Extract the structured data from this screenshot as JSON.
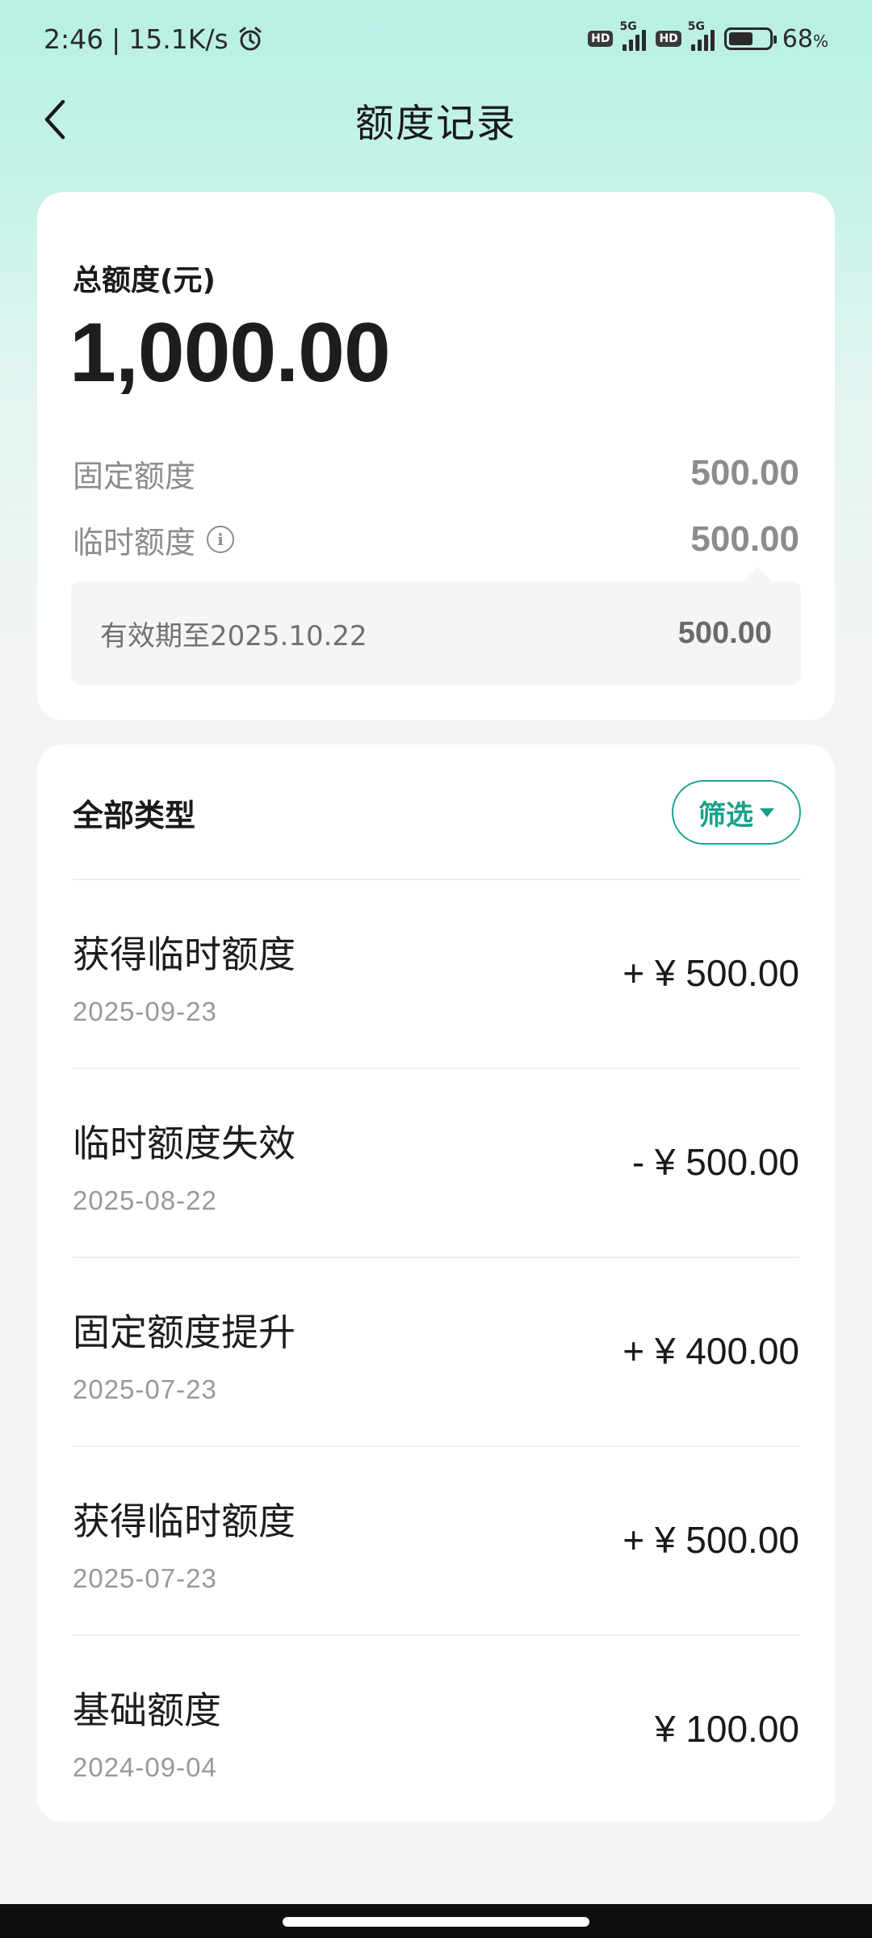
{
  "status_bar": {
    "time": "2:46",
    "separator": "|",
    "net_speed": "15.1K/s",
    "hd1": "HD",
    "net1": "5G",
    "hd2": "HD",
    "net2": "5G",
    "battery": "68",
    "battery_unit": "%"
  },
  "header": {
    "title": "额度记录"
  },
  "summary": {
    "total_label": "总额度(元)",
    "total_amount": "1,000.00",
    "fixed_label": "固定额度",
    "fixed_value": "500.00",
    "temp_label": "临时额度",
    "temp_value": "500.00",
    "validity_label": "有效期至2025.10.22",
    "validity_value": "500.00"
  },
  "records": {
    "type_label": "全部类型",
    "filter_label": "筛选",
    "items": [
      {
        "title": "获得临时额度",
        "date": "2025-09-23",
        "amount": "+ ¥ 500.00"
      },
      {
        "title": "临时额度失效",
        "date": "2025-08-22",
        "amount": "- ¥ 500.00"
      },
      {
        "title": "固定额度提升",
        "date": "2025-07-23",
        "amount": "+ ¥ 400.00"
      },
      {
        "title": "获得临时额度",
        "date": "2025-07-23",
        "amount": "+ ¥ 500.00"
      },
      {
        "title": "基础额度",
        "date": "2024-09-04",
        "amount": "¥ 100.00"
      }
    ]
  },
  "colors": {
    "accent": "#17a188",
    "header_gradient_top": "#b8f0e4",
    "page_bg": "#f2f4f5"
  }
}
